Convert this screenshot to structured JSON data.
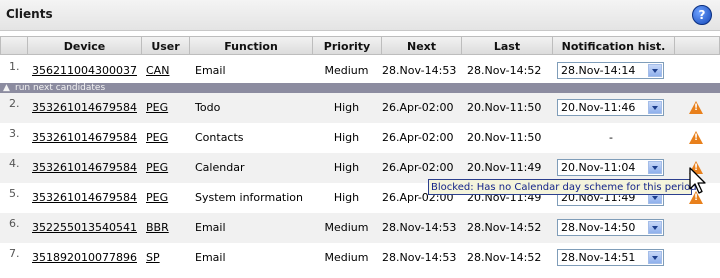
{
  "panel": {
    "title": "Clients",
    "help_label": "?"
  },
  "columns": [
    "Device",
    "User",
    "Function",
    "Priority",
    "Next",
    "Last",
    "Notification hist."
  ],
  "group_label": "run next candidates",
  "rows": [
    {
      "num": "1.",
      "device": "356211004300037",
      "user": "CAN",
      "function": "Email",
      "priority": "Medium",
      "next": "28.Nov-14:53",
      "last": "28.Nov-14:52",
      "notif": "28.Nov-14:14",
      "notif_type": "select",
      "warning": false
    },
    {
      "num": "2.",
      "device": "353261014679584",
      "user": "PEG",
      "function": "Todo",
      "priority": "High",
      "next": "26.Apr-02:00",
      "last": "20.Nov-11:50",
      "notif": "20.Nov-11:46",
      "notif_type": "select",
      "warning": true
    },
    {
      "num": "3.",
      "device": "353261014679584",
      "user": "PEG",
      "function": "Contacts",
      "priority": "High",
      "next": "26.Apr-02:00",
      "last": "20.Nov-11:50",
      "notif": "-",
      "notif_type": "text",
      "warning": true
    },
    {
      "num": "4.",
      "device": "353261014679584",
      "user": "PEG",
      "function": "Calendar",
      "priority": "High",
      "next": "26.Apr-02:00",
      "last": "20.Nov-11:49",
      "notif": "20.Nov-11:04",
      "notif_type": "select",
      "warning": true
    },
    {
      "num": "5.",
      "device": "353261014679584",
      "user": "PEG",
      "function": "System information",
      "priority": "High",
      "next": "26.Apr-02:00",
      "last": "20.Nov-11:49",
      "notif": "20.Nov-11:49",
      "notif_type": "select",
      "warning": true
    },
    {
      "num": "6.",
      "device": "352255013540541",
      "user": "BBR",
      "function": "Email",
      "priority": "Medium",
      "next": "28.Nov-14:53",
      "last": "28.Nov-14:52",
      "notif": "28.Nov-14:50",
      "notif_type": "select",
      "warning": false
    },
    {
      "num": "7.",
      "device": "351892010077896",
      "user": "SP",
      "function": "Email",
      "priority": "Medium",
      "next": "28.Nov-14:53",
      "last": "28.Nov-14:52",
      "notif": "28.Nov-14:51",
      "notif_type": "select",
      "warning": false
    }
  ],
  "tooltip": "Blocked: Has no Calendar day scheme for this period!",
  "colors": {
    "header_bg": "#e8e8e8",
    "group_bar": "#8c8ca0",
    "warning": "#e8801c",
    "tooltip_border": "#2c3f8e"
  },
  "icons": {
    "help": "help-icon",
    "warning": "warning-icon",
    "dropdown": "chevron-down-icon",
    "cursor": "mouse-cursor-icon"
  }
}
